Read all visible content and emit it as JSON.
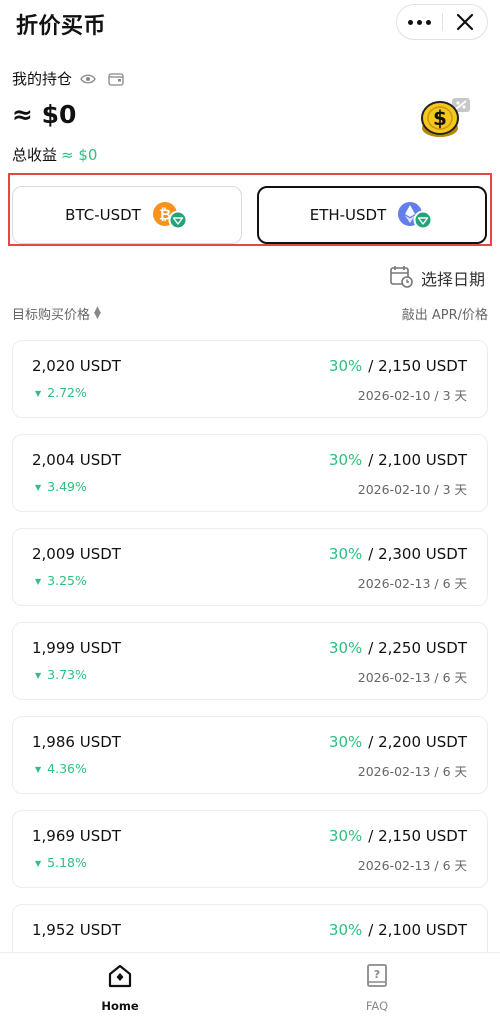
{
  "header": {
    "title": "折价买币"
  },
  "summary": {
    "holdings_label": "我的持仓",
    "amount": "≈ $0",
    "profit_label": "总收益",
    "profit_value": "≈ $0"
  },
  "pairs": [
    {
      "label": "BTC-USDT",
      "icon": "bitcoin-icon",
      "selected": false
    },
    {
      "label": "ETH-USDT",
      "icon": "ethereum-icon",
      "selected": true
    }
  ],
  "date_picker": {
    "label": "选择日期"
  },
  "list_header": {
    "left": "目标购买价格",
    "right": "敲出 APR/价格"
  },
  "offers": [
    {
      "target_price": "2,020 USDT",
      "change": "2.72%",
      "apr": "30%",
      "knockout_price": "/ 2,150 USDT",
      "date_term": "2026-02-10 / 3 天"
    },
    {
      "target_price": "2,004 USDT",
      "change": "3.49%",
      "apr": "30%",
      "knockout_price": "/ 2,100 USDT",
      "date_term": "2026-02-10 / 3 天"
    },
    {
      "target_price": "2,009 USDT",
      "change": "3.25%",
      "apr": "30%",
      "knockout_price": "/ 2,300 USDT",
      "date_term": "2026-02-13 / 6 天"
    },
    {
      "target_price": "1,999 USDT",
      "change": "3.73%",
      "apr": "30%",
      "knockout_price": "/ 2,250 USDT",
      "date_term": "2026-02-13 / 6 天"
    },
    {
      "target_price": "1,986 USDT",
      "change": "4.36%",
      "apr": "30%",
      "knockout_price": "/ 2,200 USDT",
      "date_term": "2026-02-13 / 6 天"
    },
    {
      "target_price": "1,969 USDT",
      "change": "5.18%",
      "apr": "30%",
      "knockout_price": "/ 2,150 USDT",
      "date_term": "2026-02-13 / 6 天"
    },
    {
      "target_price": "1,952 USDT",
      "change": "",
      "apr": "30%",
      "knockout_price": "/ 2,100 USDT",
      "date_term": ""
    }
  ],
  "tabbar": {
    "home_label": "Home",
    "faq_label": "FAQ"
  },
  "colors": {
    "accent_green": "#2fbf7f",
    "highlight_red": "#e54646",
    "coin_gold": "#f5c71a",
    "btc_orange": "#f7931a",
    "tether_green": "#26a17b",
    "eth_purple": "#627eea"
  }
}
